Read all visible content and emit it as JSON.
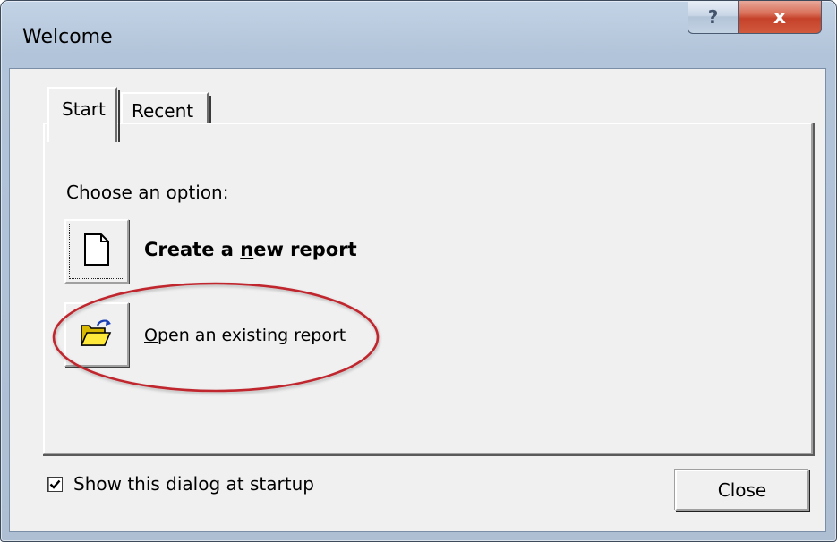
{
  "window": {
    "title": "Welcome",
    "help_glyph": "?",
    "close_glyph": "x"
  },
  "tabs": [
    {
      "label": "Start",
      "selected": true
    },
    {
      "label": "Recent",
      "selected": false
    }
  ],
  "start_page": {
    "prompt": "Choose an option:",
    "options": [
      {
        "icon": "new-document-icon",
        "label_prefix": "Create a ",
        "label_accel": "n",
        "label_suffix": "ew report",
        "emphasis": "bold"
      },
      {
        "icon": "open-folder-icon",
        "label_prefix": "",
        "label_accel": "O",
        "label_suffix": "pen an existing report",
        "highlighted_with": "red-ellipse"
      }
    ]
  },
  "footer": {
    "show_at_startup_label": "Show this dialog at startup",
    "show_at_startup_checked": true,
    "close_button_label": "Close"
  },
  "colors": {
    "highlight_ellipse": "#c0272d",
    "close_caption": "#c5412a",
    "frame": "#b2c4d9",
    "client_bg": "#f0f0f0"
  }
}
